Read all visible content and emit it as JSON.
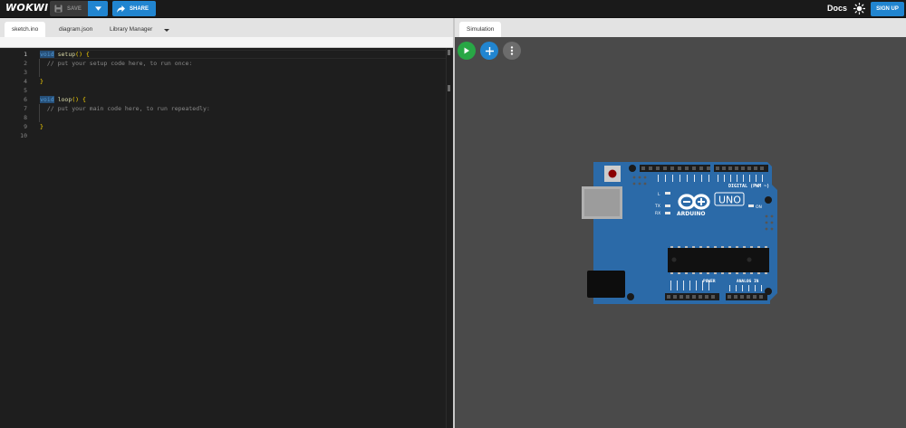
{
  "app": {
    "logo": "WOKWI"
  },
  "toolbar": {
    "save_label": "SAVE",
    "share_label": "SHARE",
    "docs_label": "Docs",
    "signup_label": "SIGN UP"
  },
  "editor": {
    "tabs": [
      {
        "label": "sketch.ino",
        "active": true
      },
      {
        "label": "diagram.json",
        "active": false
      },
      {
        "label": "Library Manager",
        "active": false
      }
    ],
    "line_numbers": [
      "1",
      "2",
      "3",
      "4",
      "5",
      "6",
      "7",
      "8",
      "9",
      "10"
    ],
    "lines": [
      {
        "keyword": "void",
        "name": "setup",
        "parens": "()",
        "brace": "{",
        "comment": ""
      },
      {
        "comment": "// put your setup code here, to run once:"
      },
      {
        "comment": ""
      },
      {
        "brace": "}"
      },
      {
        "comment": ""
      },
      {
        "keyword": "void",
        "name": "loop",
        "parens": "()",
        "brace": "{",
        "comment": ""
      },
      {
        "comment": "// put your main code here, to run repeatedly:"
      },
      {
        "comment": ""
      },
      {
        "brace": "}"
      },
      {
        "comment": ""
      }
    ]
  },
  "simulation": {
    "tab_label": "Simulation",
    "board": {
      "brand": "ARDUINO",
      "model": "UNO",
      "digital_label": "DIGITAL (PWM ~)",
      "power_label": "POWER",
      "analog_label": "ANALOG IN",
      "led_labels": [
        "L",
        "TX",
        "RX"
      ],
      "on_label": "ON"
    }
  },
  "colors": {
    "accent": "#2185d0",
    "run": "#28a745",
    "board": "#2b6aa8"
  }
}
